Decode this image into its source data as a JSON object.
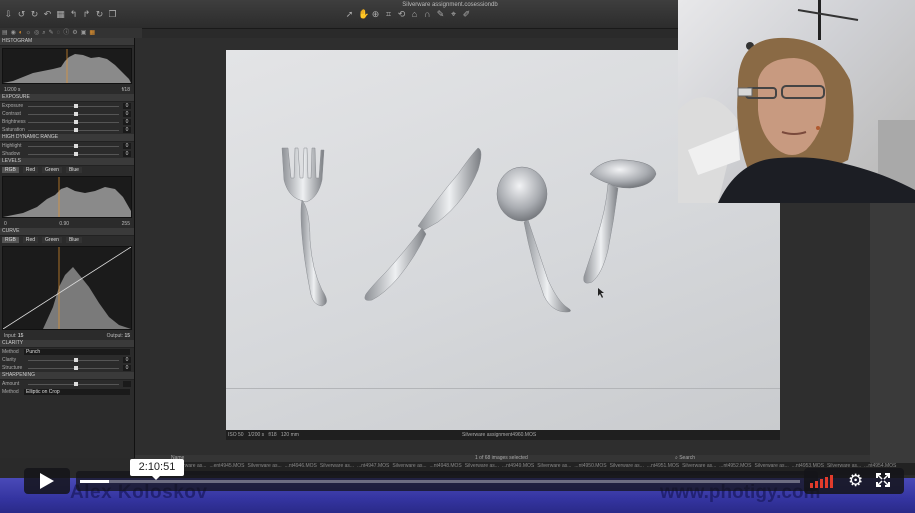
{
  "app": {
    "window_title": "Silverware assignment.cosessiondb"
  },
  "left_panel": {
    "histogram_header": "HISTOGRAM",
    "shutter": "1/200 s",
    "aperture": "f/18",
    "exposure_header": "EXPOSURE",
    "exposure_rows": [
      {
        "label": "Exposure",
        "value": "0"
      },
      {
        "label": "Contrast",
        "value": "0"
      },
      {
        "label": "Brightness",
        "value": "0"
      },
      {
        "label": "Saturation",
        "value": "0"
      }
    ],
    "hdr_header": "HIGH DYNAMIC RANGE",
    "hdr_rows": [
      {
        "label": "Highlight",
        "value": "0"
      },
      {
        "label": "Shadow",
        "value": "0"
      }
    ],
    "levels_header": "LEVELS",
    "channels": [
      "RGB",
      "Red",
      "Green",
      "Blue"
    ],
    "levels_low": "0",
    "levels_mid": "0.90",
    "levels_high": "255",
    "levels_top_right": "255",
    "curve_header": "CURVE",
    "curve_input_label": "Input:",
    "curve_input": "15",
    "curve_output_label": "Output:",
    "curve_output": "15",
    "clarity_header": "CLARITY",
    "clarity_method_label": "Method",
    "clarity_method": "Punch",
    "clarity_rows": [
      {
        "label": "Clarity",
        "value": "0"
      },
      {
        "label": "Structure",
        "value": "0"
      }
    ],
    "sharpening_header": "SHARPENING",
    "sharpening_rows": [
      {
        "label": "Amount",
        "value": ""
      }
    ],
    "vignetting_method_label": "Method",
    "vignetting_method": "Elliptic on Crop"
  },
  "viewer": {
    "iso": "ISO 50",
    "shutter": "1/200 s",
    "aperture": "f/18",
    "focal": "120 mm",
    "filename": "Silverware assignment4960.MOS"
  },
  "browser": {
    "name_col": "Name",
    "count": "1 of 68 images selected",
    "search_placeholder": "Search",
    "files": [
      "...nt4944.MOS",
      "Silverware as...",
      "...ent4945.MOS",
      "Silverware as...",
      "...nt4946.MOS",
      "Silverware as...",
      "...nt4947.MOS",
      "Silverware as...",
      "...nt4948.MOS",
      "Silverware as...",
      "...nt4949.MOS",
      "Silverware as...",
      "...nt4950.MOS",
      "Silverware as...",
      "...nt4951.MOS",
      "Silverware as...",
      "...nt4952.MOS",
      "Silverware as...",
      "...nt4953.MOS",
      "Silverware as...",
      "...nt4954.MOS"
    ]
  },
  "player": {
    "time": "2:10:51",
    "progress": 0.04,
    "brand_name": "Alex Koloskov",
    "brand_site": "www.photigy.com",
    "accent_color": "#e23b2b"
  }
}
